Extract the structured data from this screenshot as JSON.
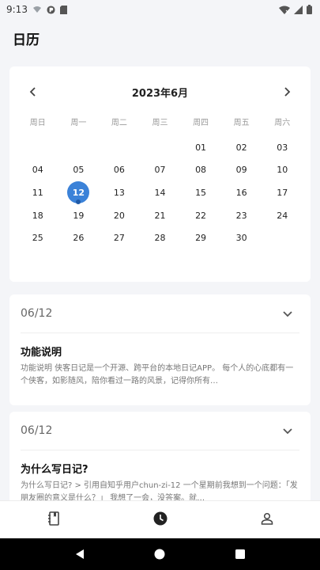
{
  "status_bar": {
    "time": "9:13",
    "icons": [
      "wifi-calling-icon",
      "vpn-key-icon",
      "sd-card-icon",
      "wifi-icon",
      "signal-icon",
      "battery-icon"
    ]
  },
  "page": {
    "title": "日历"
  },
  "calendar": {
    "month_label": "2023年6月",
    "prev_icon": "chevron-left-icon",
    "next_icon": "chevron-right-icon",
    "weekdays": [
      "周日",
      "周一",
      "周二",
      "周三",
      "周四",
      "周五",
      "周六"
    ],
    "leading_blanks": 4,
    "days": [
      "01",
      "02",
      "03",
      "04",
      "05",
      "06",
      "07",
      "08",
      "09",
      "10",
      "11",
      "12",
      "13",
      "14",
      "15",
      "16",
      "17",
      "18",
      "19",
      "20",
      "21",
      "22",
      "23",
      "24",
      "25",
      "26",
      "27",
      "28",
      "29",
      "30"
    ],
    "selected_day": "12",
    "marked_days": [
      "12"
    ],
    "accent_color": "#3b82d8"
  },
  "entries": [
    {
      "date": "06/12",
      "title": "功能说明",
      "body": "功能说明  侠客日记是一个开源、跨平台的本地日记APP。  每个人的心底都有一个侠客，如影随风，陪你看过一路的风景，记得你所有…"
    },
    {
      "date": "06/12",
      "title": "为什么写日记?",
      "body": "为什么写日记?  > 引用自知乎用户chun-zi-12  一个星期前我想到一个问题：「发朋友圈的意义是什么？」  我想了一会，没答案。就…"
    }
  ],
  "bottom_nav": {
    "tabs": [
      {
        "name": "diary",
        "icon": "notebook-icon"
      },
      {
        "name": "calendar",
        "icon": "clock-icon"
      },
      {
        "name": "profile",
        "icon": "person-icon"
      }
    ],
    "active": "calendar"
  },
  "system_nav": {
    "icons": [
      "back-icon",
      "home-icon",
      "recents-icon"
    ]
  }
}
